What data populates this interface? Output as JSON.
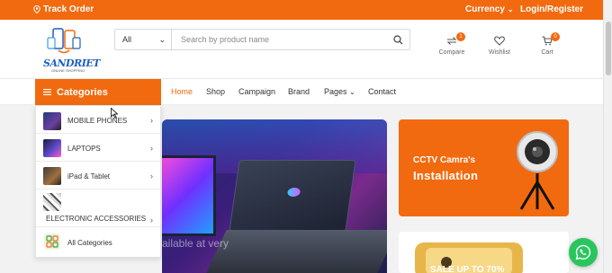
{
  "topbar": {
    "track_order": "Track Order",
    "currency": "Currency",
    "login_register": "Login/Register"
  },
  "logo": {
    "text": "SANDRIET",
    "sub": "ONLINE SHOPPING"
  },
  "search": {
    "category_value": "All",
    "placeholder": "Search by product name"
  },
  "header_actions": {
    "compare_label": "Compare",
    "compare_count": "1",
    "wishlist_label": "Wishlist",
    "cart_label": "Cart",
    "cart_count": "0"
  },
  "nav": {
    "categories_label": "Categories",
    "links": [
      "Home",
      "Shop",
      "Campaign",
      "Brand",
      "Pages",
      "Contact"
    ]
  },
  "dropdown": {
    "items": [
      {
        "label": "MOBILE PHONES"
      },
      {
        "label": "LAPTOPS"
      },
      {
        "label": "iPad & Tablet"
      },
      {
        "label": "ELECTRONIC ACCESSORIES"
      },
      {
        "label": "All Categories"
      }
    ]
  },
  "banner": {
    "promo_text": "ailable at very"
  },
  "promos": {
    "cctv_line1": "CCTV Camra's",
    "cctv_line2": "Installation",
    "sale_text": "SALE UP TO 70%"
  },
  "colors": {
    "brand": "#f26a0f",
    "whatsapp": "#29c55d"
  }
}
